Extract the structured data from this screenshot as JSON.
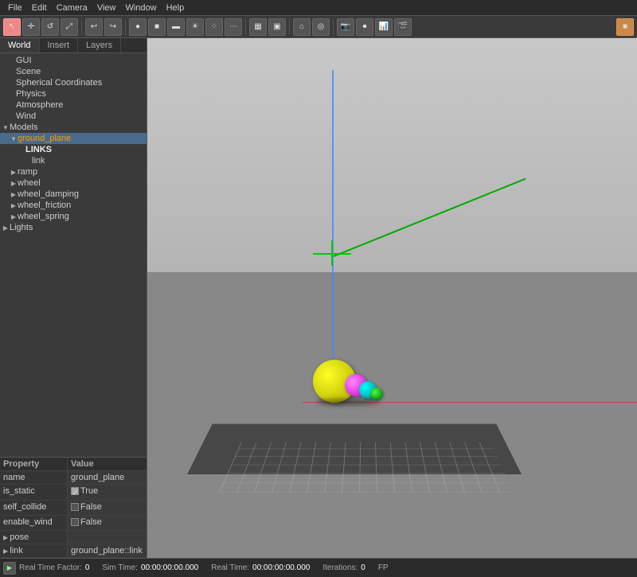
{
  "menubar": {
    "items": [
      "File",
      "Edit",
      "Camera",
      "View",
      "Window",
      "Help"
    ]
  },
  "tabs": {
    "items": [
      "World",
      "Insert",
      "Layers"
    ]
  },
  "tree": {
    "items": [
      {
        "id": "gui",
        "label": "GUI",
        "indent": 1,
        "arrow": "",
        "selected": false
      },
      {
        "id": "scene",
        "label": "Scene",
        "indent": 1,
        "arrow": "",
        "selected": false
      },
      {
        "id": "spherical",
        "label": "Spherical Coordinates",
        "indent": 1,
        "arrow": "",
        "selected": false
      },
      {
        "id": "physics",
        "label": "Physics",
        "indent": 1,
        "arrow": "",
        "selected": false
      },
      {
        "id": "atmosphere",
        "label": "Atmosphere",
        "indent": 1,
        "arrow": "",
        "selected": false
      },
      {
        "id": "wind",
        "label": "Wind",
        "indent": 1,
        "arrow": "",
        "selected": false
      },
      {
        "id": "models",
        "label": "Models",
        "indent": 1,
        "arrow": "▼",
        "selected": false
      },
      {
        "id": "ground_plane",
        "label": "ground_plane",
        "indent": 2,
        "arrow": "▼",
        "selected": true,
        "orange": true
      },
      {
        "id": "links",
        "label": "LINKS",
        "indent": 3,
        "arrow": "",
        "selected": false,
        "bold": true
      },
      {
        "id": "link",
        "label": "link",
        "indent": 4,
        "arrow": "",
        "selected": false
      },
      {
        "id": "ramp",
        "label": "ramp",
        "indent": 2,
        "arrow": "▶",
        "selected": false
      },
      {
        "id": "wheel",
        "label": "wheel",
        "indent": 2,
        "arrow": "▶",
        "selected": false
      },
      {
        "id": "wheel_damping",
        "label": "wheel_damping",
        "indent": 2,
        "arrow": "▶",
        "selected": false
      },
      {
        "id": "wheel_friction",
        "label": "wheel_friction",
        "indent": 2,
        "arrow": "▶",
        "selected": false
      },
      {
        "id": "wheel_spring",
        "label": "wheel_spring",
        "indent": 2,
        "arrow": "▶",
        "selected": false
      },
      {
        "id": "lights",
        "label": "Lights",
        "indent": 1,
        "arrow": "▶",
        "selected": false
      }
    ]
  },
  "properties": {
    "header": {
      "col1": "Property",
      "col2": "Value"
    },
    "rows": [
      {
        "prop": "name",
        "value": "ground_plane",
        "type": "text"
      },
      {
        "prop": "is_static",
        "value": "True",
        "type": "checkbox_true"
      },
      {
        "prop": "self_collide",
        "value": "False",
        "type": "checkbox_false"
      },
      {
        "prop": "enable_wind",
        "value": "False",
        "type": "checkbox_false"
      },
      {
        "prop": "pose",
        "value": "",
        "type": "expand"
      },
      {
        "prop": "link",
        "value": "ground_plane::link",
        "type": "expand_val"
      }
    ]
  },
  "statusbar": {
    "play_label": "▶",
    "realtime_label": "Real Time Factor:",
    "realtime_val": "0",
    "simtime_label": "Sim Time:",
    "simtime_val": "00:00:00:00.000",
    "realtime2_label": "Real Time:",
    "realtime2_val": "00:00:00:00.000",
    "iterations_label": "Iterations:",
    "iterations_val": "0",
    "fps_label": "FP"
  },
  "toolbar": {
    "tools": [
      "↖",
      "+",
      "↺",
      "□",
      "◁",
      "▷",
      "⬡",
      "⬡",
      "⬡",
      "☀",
      "☁",
      "⋯",
      "▣",
      "▦",
      "►",
      "◉",
      "◎",
      "⬡",
      "⬡",
      "◉",
      "◎",
      "♦"
    ]
  },
  "viewport": {
    "background_top": "#b0b0b0",
    "background_bottom": "#888888"
  }
}
